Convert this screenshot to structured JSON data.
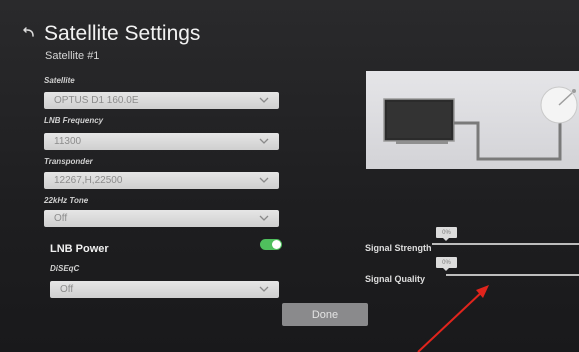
{
  "header": {
    "title": "Satellite Settings",
    "subtitle": "Satellite #1",
    "back_icon": "back-arrow-icon"
  },
  "fields": {
    "satellite": {
      "label": "Satellite",
      "value": "OPTUS D1 160.0E"
    },
    "lnb_frequency": {
      "label": "LNB Frequency",
      "value": "11300"
    },
    "transponder": {
      "label": "Transponder",
      "value": "12267,H,22500"
    },
    "tone_22khz": {
      "label": "22kHz Tone",
      "value": "Off"
    },
    "diseqc": {
      "label": "DiSEqC",
      "value": "Off"
    }
  },
  "lnb_power": {
    "label": "LNB Power",
    "on": true,
    "color": "#4fbf5d"
  },
  "signal": {
    "strength": {
      "label": "Signal Strength",
      "value": "0%"
    },
    "quality": {
      "label": "Signal Quality",
      "value": "0%"
    }
  },
  "done_label": "Done",
  "colors": {
    "annotation_arrow": "#e0241c",
    "toggle_on": "#4fbf5d"
  }
}
